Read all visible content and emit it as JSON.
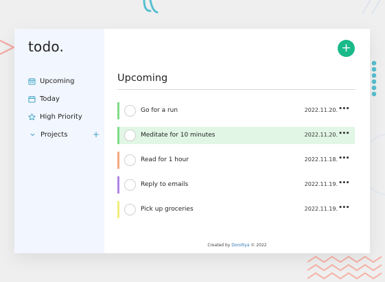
{
  "app": {
    "logo": "todo."
  },
  "sidebar": {
    "items": [
      {
        "label": "Upcoming",
        "icon": "calendar-icon"
      },
      {
        "label": "Today",
        "icon": "calendar-blank-icon"
      },
      {
        "label": "High Priority",
        "icon": "star-icon"
      }
    ],
    "projects": {
      "label": "Projects",
      "icon": "chevron-down-icon",
      "add": "+"
    }
  },
  "main": {
    "add_button": "+",
    "heading": "Upcoming",
    "tasks": [
      {
        "title": "Go for a run",
        "date": "2022.11.20.",
        "color": "#7fdc8a",
        "more": "•••"
      },
      {
        "title": "Meditate for 10 minutes",
        "date": "2022.11.20.",
        "color": "#7fdc8a",
        "more": "•••"
      },
      {
        "title": "Read for 1 hour",
        "date": "2022.11.18.",
        "color": "#f5a77e",
        "more": "•••"
      },
      {
        "title": "Reply to emails",
        "date": "2022.11.19.",
        "color": "#b284e6",
        "more": "•••"
      },
      {
        "title": "Pick up groceries",
        "date": "2022.11.19.",
        "color": "#f4ec7c",
        "more": "•••"
      }
    ],
    "highlight_color": "#e1f6e4"
  },
  "footer": {
    "prefix": "Created by ",
    "author": "Dorottya",
    "suffix": " © 2022"
  },
  "colors": {
    "accent": "#19b98a",
    "link": "#2d77b8",
    "icon": "#3aa1c2",
    "sidebar_bg": "#f2f6fe"
  }
}
